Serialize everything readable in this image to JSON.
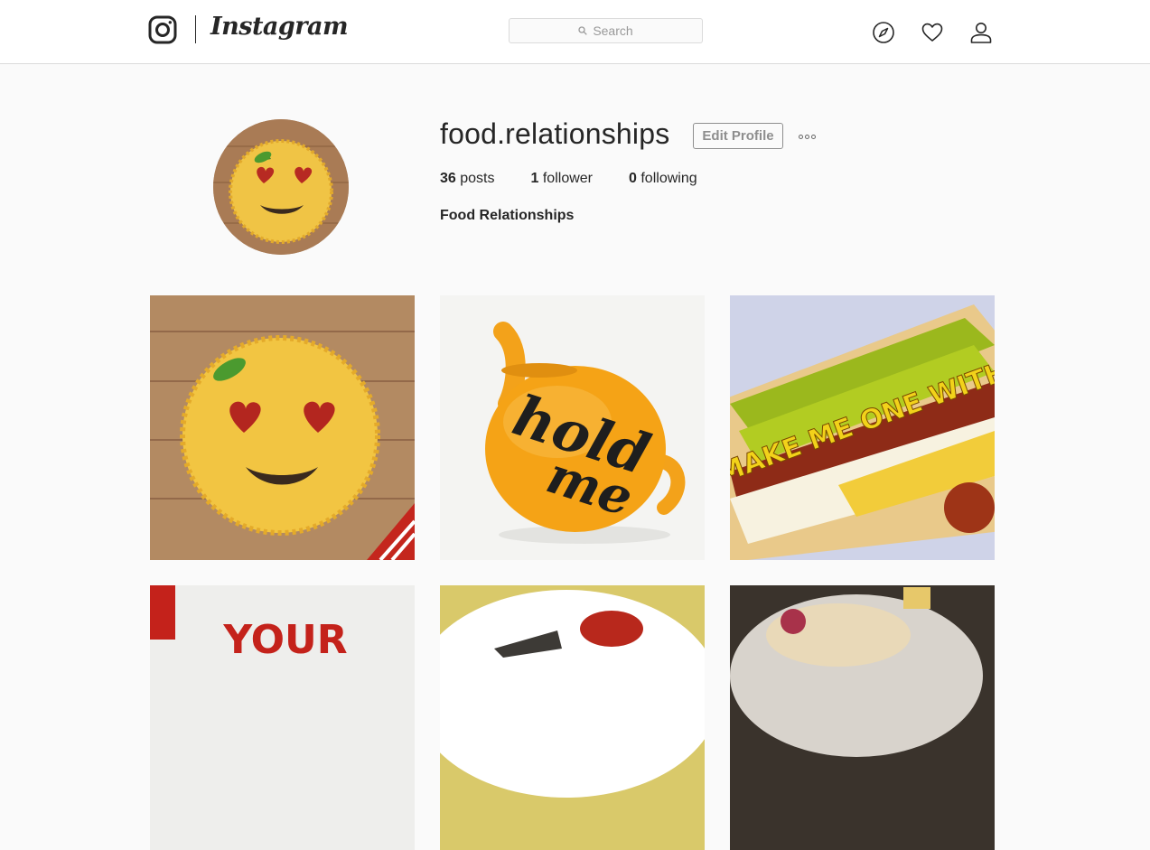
{
  "nav": {
    "wordmark": "Instagram",
    "search_placeholder": "Search",
    "icons": [
      "instagram-logo-icon",
      "search-icon",
      "compass-icon",
      "heart-icon",
      "person-icon"
    ]
  },
  "profile": {
    "username": "food.relationships",
    "edit_label": "Edit Profile",
    "posts_count": "36",
    "posts_label": "posts",
    "followers_count": "1",
    "followers_label": "follower",
    "following_count": "0",
    "following_label": "following",
    "full_name": "Food Relationships"
  },
  "posts": [
    {
      "subject": "spaghetti-heart-eyes-emoji"
    },
    {
      "subject": "orange-teapot",
      "lettering": "hold me"
    },
    {
      "subject": "hot-dog",
      "lettering": "MAKE ME ONE WITH"
    },
    {
      "subject": "ketchup-lettering",
      "lettering": "YOUR"
    },
    {
      "subject": "plate-with-sauce"
    },
    {
      "subject": "sandwich-plate"
    }
  ],
  "colors": {
    "background": "#fafafa",
    "border": "#dbdbdb",
    "text": "#262626",
    "muted": "#8e8e8e"
  }
}
